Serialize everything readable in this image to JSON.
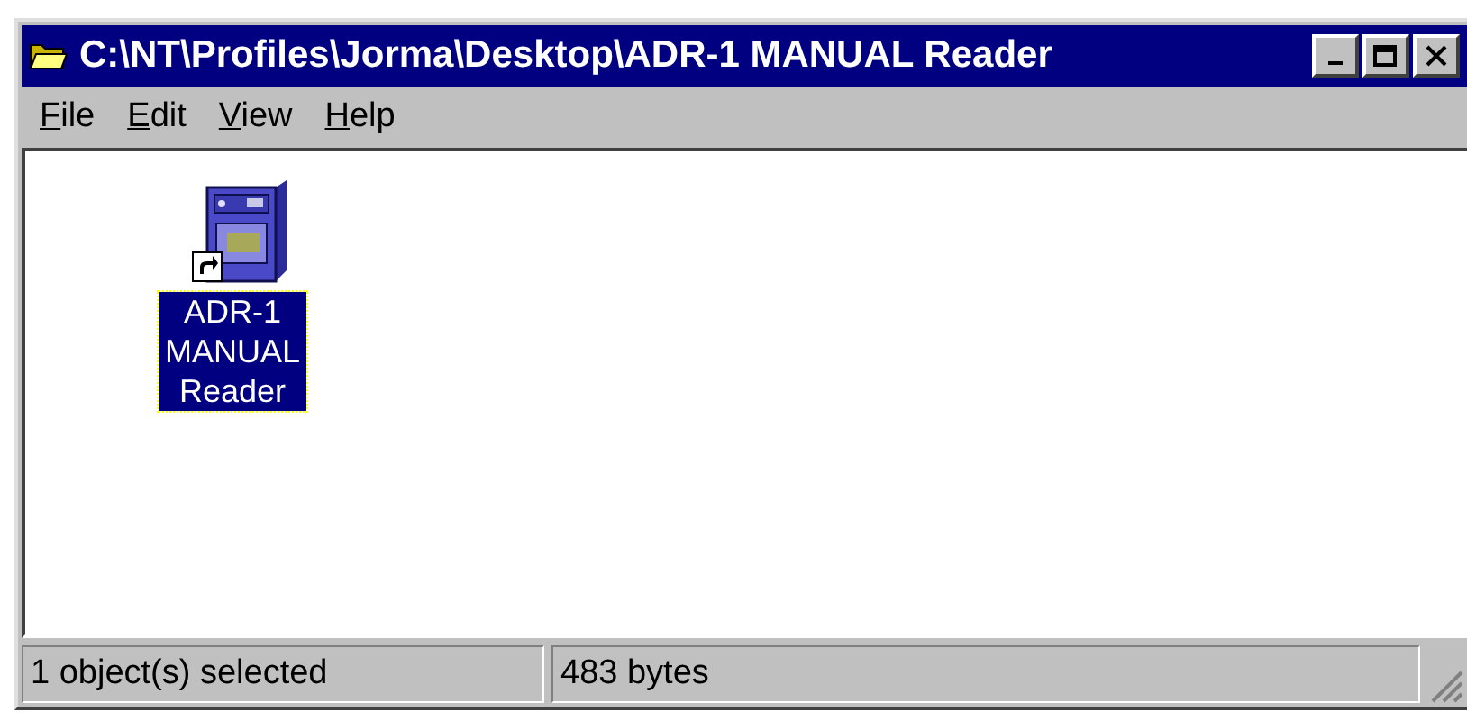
{
  "window": {
    "title": "C:\\NT\\Profiles\\Jorma\\Desktop\\ADR-1 MANUAL Reader"
  },
  "menu": [
    {
      "label": "File"
    },
    {
      "label": "Edit"
    },
    {
      "label": "View"
    },
    {
      "label": "Help"
    }
  ],
  "items": [
    {
      "label": "ADR-1 MANUAL Reader",
      "selected": true,
      "shortcut": true
    }
  ],
  "status_bar": [
    "1 object(s) selected",
    "483 bytes"
  ]
}
